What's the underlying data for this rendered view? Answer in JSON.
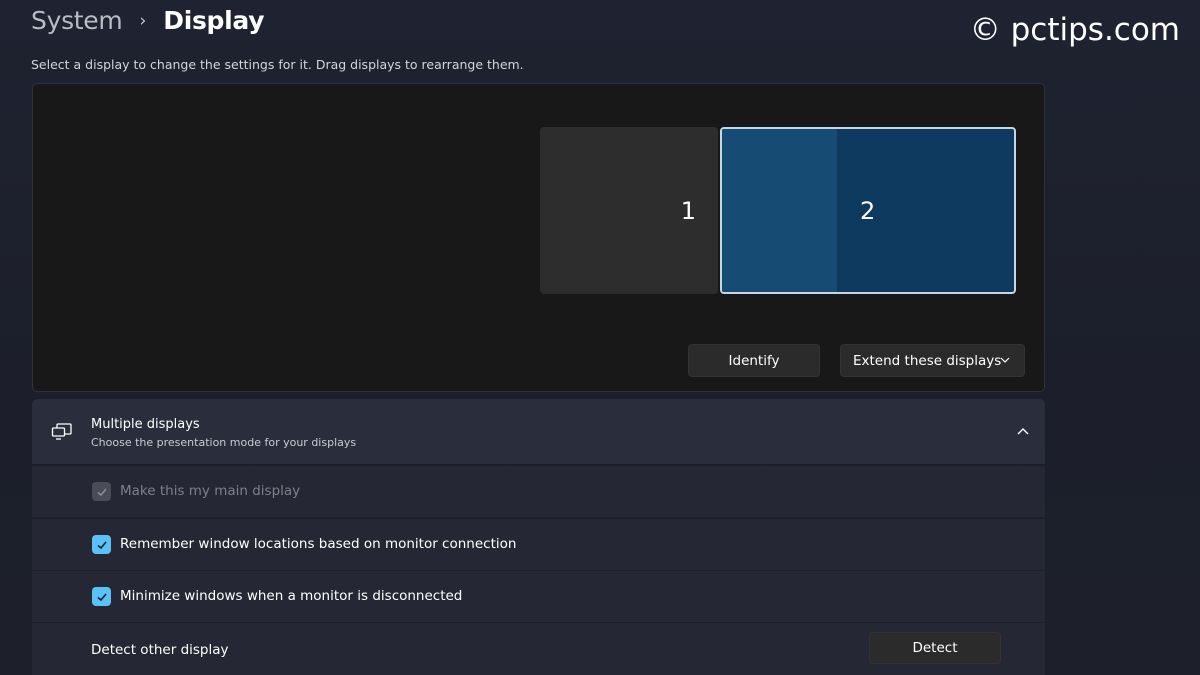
{
  "breadcrumb": {
    "parent": "System",
    "separator": "›",
    "current": "Display"
  },
  "watermark": "© pctips.com",
  "instructions": "Select a display to change the settings for it. Drag displays to rearrange them.",
  "arrangement": {
    "monitors": [
      {
        "label": "1",
        "selected": false
      },
      {
        "label": "2",
        "selected": true
      }
    ],
    "identify_label": "Identify",
    "mode_select": {
      "value": "Extend these displays",
      "icon": "chevron-down-icon"
    }
  },
  "multiple_displays": {
    "icon": "multiple-displays-icon",
    "title": "Multiple displays",
    "subtitle": "Choose the presentation mode for your displays",
    "expanded": true,
    "options": [
      {
        "label": "Make this my main display",
        "checked": true,
        "disabled": true
      },
      {
        "label": "Remember window locations based on monitor connection",
        "checked": true,
        "disabled": false
      },
      {
        "label": "Minimize windows when a monitor is disconnected",
        "checked": true,
        "disabled": false
      }
    ],
    "detect": {
      "label": "Detect other display",
      "button_label": "Detect"
    }
  },
  "colors": {
    "accent": "#5bc2f5",
    "selected_monitor": "#0f3a5f",
    "background": "#1f2230"
  }
}
